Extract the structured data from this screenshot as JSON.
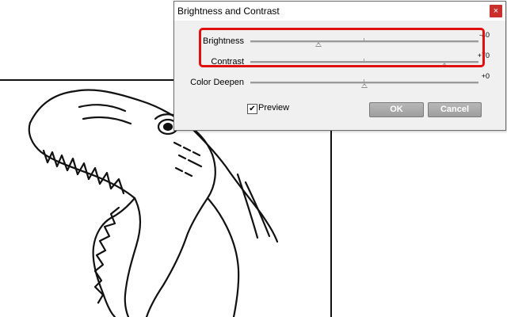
{
  "dialog": {
    "title": "Brightness and Contrast",
    "close_glyph": "×",
    "sliders": [
      {
        "label": "Brightness",
        "value_text": "-40",
        "value": -40,
        "min": -100,
        "max": 100
      },
      {
        "label": "Contrast",
        "value_text": "+70",
        "value": 70,
        "min": -100,
        "max": 100
      },
      {
        "label": "Color Deepen",
        "value_text": "+0",
        "value": 0,
        "min": -100,
        "max": 100
      }
    ],
    "preview": {
      "label": "Preview",
      "checked": true,
      "check_glyph": "✔"
    },
    "buttons": {
      "ok": "OK",
      "cancel": "Cancel"
    }
  },
  "colors": {
    "highlight": "#e01010",
    "close_button": "#c9302c",
    "button_face": "#a8a8a8"
  },
  "icons": {
    "close": "close-icon",
    "check": "checkmark-icon",
    "thumb": "triangle-up-icon"
  }
}
